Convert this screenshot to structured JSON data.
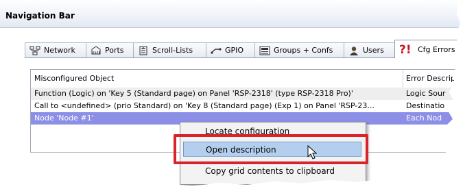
{
  "window": {
    "title": "Navigation Bar"
  },
  "tabs": [
    {
      "label": "Network",
      "icon": "network-icon"
    },
    {
      "label": "Ports",
      "icon": "ports-icon"
    },
    {
      "label": "Scroll-Lists",
      "icon": "scroll-lists-icon"
    },
    {
      "label": "GPIO",
      "icon": "gpio-icon"
    },
    {
      "label": "Groups + Confs",
      "icon": "groups-confs-icon"
    },
    {
      "label": "Users",
      "icon": "users-icon"
    },
    {
      "label": "Cfg Errors",
      "icon": "cfg-errors-icon",
      "active": true
    }
  ],
  "grid": {
    "columns": [
      "Misconfigured Object",
      "Error Descrip"
    ],
    "rows": [
      [
        "Function (Logic) on 'Key 5 (Standard page) on Panel 'RSP-2318' (type RSP-2318 Pro)'",
        "Logic Sour"
      ],
      [
        "Call to <undefined> (prio Standard) on 'Key 8 (Standard page) (Exp 1) on Panel 'RSP-23...",
        "Destinatio"
      ],
      [
        "Node 'Node #1'",
        "Each Nod"
      ]
    ],
    "selected_row": 2
  },
  "context_menu": {
    "items": [
      {
        "label": "Locate configuration"
      },
      {
        "label": "Open description",
        "highlighted": true
      },
      {
        "label": "Copy grid contents to clipboard"
      }
    ]
  },
  "colors": {
    "highlight": "#d9232a",
    "selected_row": "#8c8fe6",
    "menu_hover": "#b4cfee",
    "errors_icon": "#c6151c"
  }
}
